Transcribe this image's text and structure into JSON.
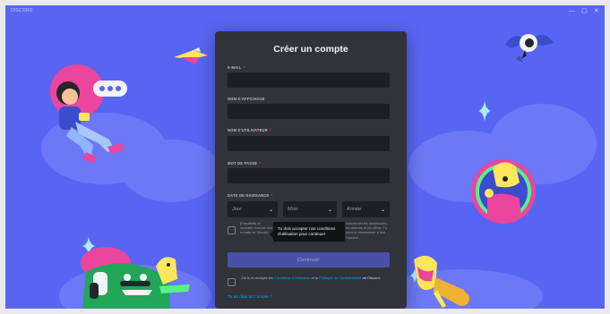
{
  "window": {
    "title": "DISCORD",
    "controls": {
      "minimize": "—",
      "maximize": "▢",
      "close": "✕"
    }
  },
  "form": {
    "title": "Créer un compte",
    "email_label": "E-MAIL",
    "display_name_label": "NOM D'AFFICHAGE",
    "username_label": "NOM D'UTILISATEUR",
    "password_label": "MOT DE PASSE",
    "birthdate_label": "DATE DE NAISSANCE",
    "required_marker": "*",
    "day_placeholder": "Jour",
    "month_placeholder": "Mois",
    "year_placeholder": "Année",
    "chevron": "⌄",
    "email_opt_in_left": "(Facultatif) Je souhaite recevoir des e-mails de Discord",
    "email_opt_in_right": "concernant les nouveautés, les astuces et les offres. Tu peux te désabonner à tout moment.",
    "continue_button": "Continuer",
    "terms_prefix": "J'ai lu et accepté les ",
    "terms_link": "Conditions d'Utilisation",
    "terms_middle": " et la ",
    "privacy_link": "Politique de Confidentialité",
    "terms_suffix": " de Discord.",
    "login_link": "Tu as déjà un compte ?"
  },
  "tooltip": {
    "text": "Tu dois accepter nos conditions d'utilisation pour continuer"
  },
  "colors": {
    "background": "#5865f2",
    "modal": "#313338",
    "input": "#1e1f22",
    "link": "#00a8fc",
    "required": "#f23f43"
  }
}
